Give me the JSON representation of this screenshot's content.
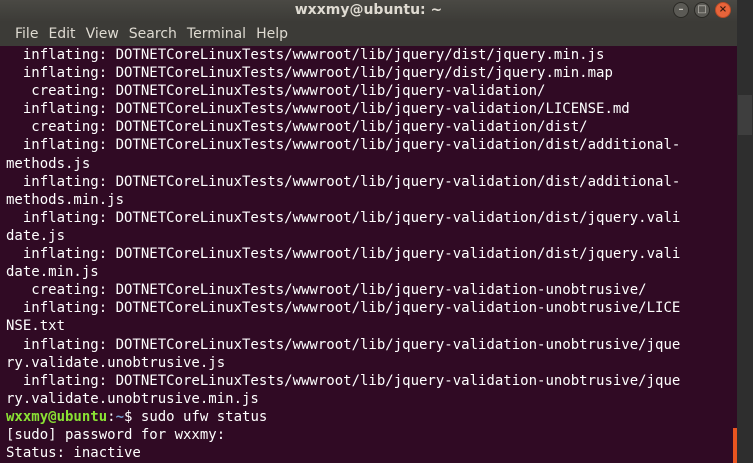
{
  "window": {
    "title": "wxxmy@ubuntu: ~",
    "controls": {
      "minimize": "–",
      "maximize": "□",
      "close": "×"
    }
  },
  "menu": [
    "File",
    "Edit",
    "View",
    "Search",
    "Terminal",
    "Help"
  ],
  "terminal": {
    "lines": [
      "  inflating: DOTNETCoreLinuxTests/wwwroot/lib/jquery/dist/jquery.min.js",
      "  inflating: DOTNETCoreLinuxTests/wwwroot/lib/jquery/dist/jquery.min.map",
      "   creating: DOTNETCoreLinuxTests/wwwroot/lib/jquery-validation/",
      "  inflating: DOTNETCoreLinuxTests/wwwroot/lib/jquery-validation/LICENSE.md",
      "   creating: DOTNETCoreLinuxTests/wwwroot/lib/jquery-validation/dist/",
      "  inflating: DOTNETCoreLinuxTests/wwwroot/lib/jquery-validation/dist/additional-",
      "methods.js",
      "  inflating: DOTNETCoreLinuxTests/wwwroot/lib/jquery-validation/dist/additional-",
      "methods.min.js",
      "  inflating: DOTNETCoreLinuxTests/wwwroot/lib/jquery-validation/dist/jquery.vali",
      "date.js",
      "  inflating: DOTNETCoreLinuxTests/wwwroot/lib/jquery-validation/dist/jquery.vali",
      "date.min.js",
      "   creating: DOTNETCoreLinuxTests/wwwroot/lib/jquery-validation-unobtrusive/",
      "  inflating: DOTNETCoreLinuxTests/wwwroot/lib/jquery-validation-unobtrusive/LICE",
      "NSE.txt",
      "  inflating: DOTNETCoreLinuxTests/wwwroot/lib/jquery-validation-unobtrusive/jque",
      "ry.validate.unobtrusive.js",
      "  inflating: DOTNETCoreLinuxTests/wwwroot/lib/jquery-validation-unobtrusive/jque",
      "ry.validate.unobtrusive.min.js"
    ],
    "prompt": {
      "user_host": "wxxmy@ubuntu",
      "separator": ":",
      "path": "~",
      "symbol": "$ ",
      "command": "sudo ufw status"
    },
    "sudo_prompt": "[sudo] password for wxxmy:",
    "status_line": "Status: inactive"
  },
  "colors": {
    "background": "#300a24",
    "prompt_user": "#8ae234",
    "prompt_path": "#729fcf",
    "accent": "#e95420"
  }
}
